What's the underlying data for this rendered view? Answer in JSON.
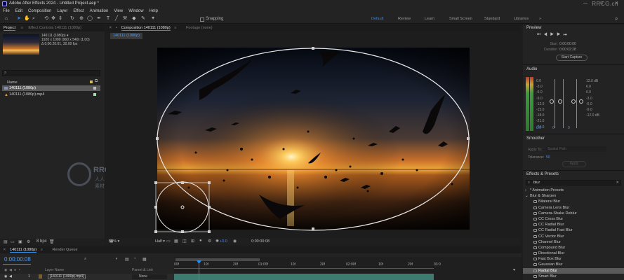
{
  "app": {
    "title": "Adobe After Effects 2024 - Untitled Project.aep *"
  },
  "menu": [
    "File",
    "Edit",
    "Composition",
    "Layer",
    "Effect",
    "Animation",
    "View",
    "Window",
    "Help"
  ],
  "toolbar": {
    "snapping_label": "Snapping",
    "workspaces": [
      "Default",
      "Review",
      "Learn",
      "Small Screen",
      "Standard",
      "Libraries"
    ],
    "search_icon": "search-icon"
  },
  "project_panel": {
    "tab_label": "Project",
    "effect_controls_tab": "Effect Controls 140111 (1080p)",
    "item_name": "140111 (1080p) ▾",
    "item_info": [
      "1920 x 1080 (960 x 540) (1.00)",
      "Δ 0;00:20:01, 30.00 fps"
    ],
    "search_placeholder": "",
    "col_name": "Name",
    "items": [
      {
        "name": "140111 (1080p)",
        "selected": true
      },
      {
        "name": "140111 (1080p).mp4",
        "selected": false
      }
    ],
    "bpc": "8 bpc"
  },
  "composition_panel": {
    "tab_label": "Composition 140111 (1080p)",
    "footage_tab": "Footage (none)",
    "comp_chip": "140111 (1080p)",
    "zoom": "50%",
    "resolution": "Half",
    "exposure": "+0.0",
    "timecode": "0:00:00:08"
  },
  "watermark": {
    "text": "RRCG",
    "subtext": "人人素材"
  },
  "top_watermark": "RRCG.cn",
  "preview_panel": {
    "title": "Preview",
    "start_label": "Start",
    "start_value": "0:00:00:00",
    "duration_label": "Duration",
    "duration_value": "0:00:02:28",
    "button": "Start Capture"
  },
  "audio_panel": {
    "title": "Audio",
    "left_scale": [
      "0.0",
      "-3.0",
      "-6.0",
      "-9.0",
      "-12.0",
      "-15.0",
      "-18.0",
      "-21.0",
      "-24.0"
    ],
    "right_scale": [
      "12.0 dB",
      "6.0",
      "0.0",
      "-6.0",
      "-12.0 dB"
    ],
    "right_scale_full": [
      "12.0 dB",
      "6.0",
      "0.0",
      "-3.0",
      "-6.0",
      "-9.0",
      "-12.0 dB"
    ],
    "mid_scale": [
      "12.0",
      "6.0",
      "0.0",
      "-6.0",
      "-12.0"
    ],
    "left_level": "0.0",
    "right_level": "0"
  },
  "smoother_panel": {
    "title": "Smoother",
    "apply_label": "Apply To:",
    "apply_value": "Spatial Path",
    "tolerance_label": "Tolerance:",
    "tolerance_value": "50",
    "apply_button": "Apply"
  },
  "effects_panel": {
    "title": "Effects & Presets",
    "search_value": "blur",
    "groups": [
      "* Animation Presets",
      "Blur & Sharpen"
    ],
    "items": [
      {
        "name": "Bilateral Blur",
        "selected": false
      },
      {
        "name": "Camera Lens Blur",
        "selected": false
      },
      {
        "name": "Camera-Shake Deblur",
        "selected": false
      },
      {
        "name": "CC Cross Blur",
        "selected": false
      },
      {
        "name": "CC Radial Blur",
        "selected": false
      },
      {
        "name": "CC Radial Fast Blur",
        "selected": false
      },
      {
        "name": "CC Vector Blur",
        "selected": false
      },
      {
        "name": "Channel Blur",
        "selected": false
      },
      {
        "name": "Compound Blur",
        "selected": false
      },
      {
        "name": "Directional Blur",
        "selected": false
      },
      {
        "name": "Fast Box Blur",
        "selected": false
      },
      {
        "name": "Gaussian Blur",
        "selected": false
      },
      {
        "name": "Radial Blur",
        "selected": true
      },
      {
        "name": "Smart Blur",
        "selected": false
      }
    ]
  },
  "timeline": {
    "tab_label": "140111 (1080p)",
    "render_queue": "Render Queue",
    "timecode": "0:00:00:08",
    "layer_name_col": "Layer Name",
    "parent_col": "Parent & Link",
    "layer_number": "1",
    "layer_name": "[140111 (1080p).mp4]",
    "parent_value": "None",
    "ruler": [
      "00f",
      "10f",
      "20f",
      "01:00f",
      "10f",
      "20f",
      "02:00f",
      "10f",
      "20f",
      "03:0"
    ]
  },
  "colors": {
    "accent": "#2d8ceb",
    "panel_bg": "#232323",
    "selection": "#5a5a5a",
    "mask_path": "#e8e8e8"
  }
}
